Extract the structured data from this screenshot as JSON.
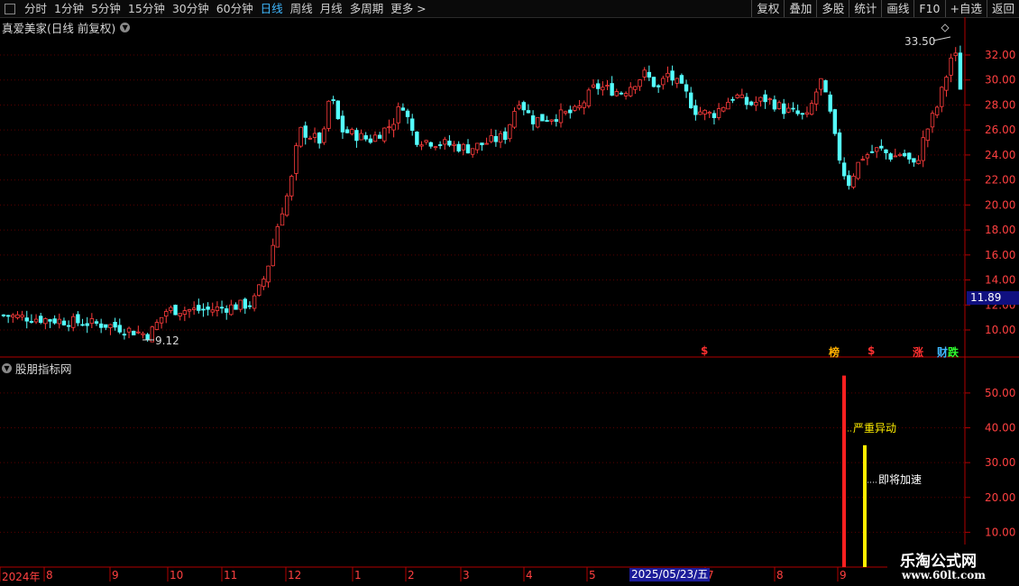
{
  "toolbar": {
    "periods": [
      "分时",
      "1分钟",
      "5分钟",
      "15分钟",
      "30分钟",
      "60分钟",
      "日线",
      "周线",
      "月线",
      "多周期",
      "更多 >"
    ],
    "active_period": "日线",
    "right_buttons": [
      "复权",
      "叠加",
      "多股",
      "统计",
      "画线",
      "F10",
      "+自选",
      "返回"
    ]
  },
  "main_title": "真爱美家(日线 前复权)",
  "sub_title": "股朋指标网",
  "price_axis": [
    "32.00",
    "30.00",
    "28.00",
    "26.00",
    "24.00",
    "22.00",
    "20.00",
    "18.00",
    "16.00",
    "14.00",
    "12.00",
    "10.00"
  ],
  "current_price": "11.89",
  "high_label": "33.50",
  "low_label": "9.12",
  "signals": [
    {
      "text": "$",
      "color": "#ff3030"
    },
    {
      "text": "榜",
      "color": "#ffb000"
    },
    {
      "text": "$",
      "color": "#ff3030"
    },
    {
      "text": "涨",
      "color": "#ff3030"
    },
    {
      "text": "财",
      "color": "#3fb8ff"
    },
    {
      "text": "跌",
      "color": "#30ff30"
    }
  ],
  "indicator_axis": [
    "50.00",
    "40.00",
    "30.00",
    "20.00",
    "10.00"
  ],
  "annotations": {
    "severe": "严重异动",
    "accelerate": "即将加速"
  },
  "x_axis": {
    "labels": [
      "2024年",
      "8",
      "9",
      "10",
      "11",
      "12",
      "1",
      "2",
      "3",
      "4",
      "5",
      "7",
      "8",
      "9"
    ],
    "cursor_date": "2025/05/23/五"
  },
  "watermark": {
    "line1": "乐淘公式网",
    "line2": "www.60lt.com"
  },
  "colors": {
    "up": "#ff3c3c",
    "down": "#54ffff",
    "grid": "#5a0000",
    "axis": "#b00000",
    "yellow": "#ffee00"
  },
  "chart_data": {
    "type": "candlestick",
    "ylim": [
      9,
      33.5
    ],
    "indicator_ylim": [
      0,
      58
    ],
    "indicator_bars": [
      {
        "name": "严重异动",
        "value": 55,
        "color": "#ff2020"
      },
      {
        "name": "即将加速",
        "value": 35,
        "color": "#ffee00"
      }
    ]
  }
}
